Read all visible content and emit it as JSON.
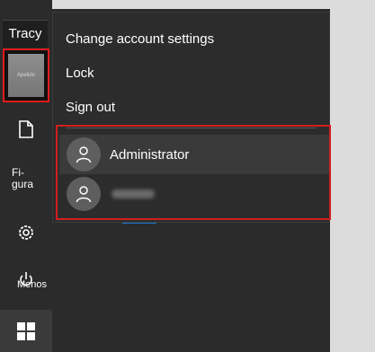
{
  "rail": {
    "user_name": "Tracy",
    "avatar_caption": "Apelido",
    "items": [
      {
        "label": "Fi-\ngura"
      },
      {
        "label": "Menos"
      }
    ]
  },
  "flyout": {
    "menu": [
      {
        "label": "Change account settings"
      },
      {
        "label": "Lock"
      },
      {
        "label": "Sign out"
      }
    ],
    "accounts": [
      {
        "name": "Administrator"
      },
      {
        "name": ""
      }
    ]
  },
  "colors": {
    "highlight_border": "#d11f1f",
    "accent_blue": "#1e77d4",
    "menu_bg": "#2c2c2c"
  },
  "icons": [
    "document-icon",
    "settings-gear-icon",
    "power-icon",
    "windows-logo-icon",
    "person-icon"
  ]
}
